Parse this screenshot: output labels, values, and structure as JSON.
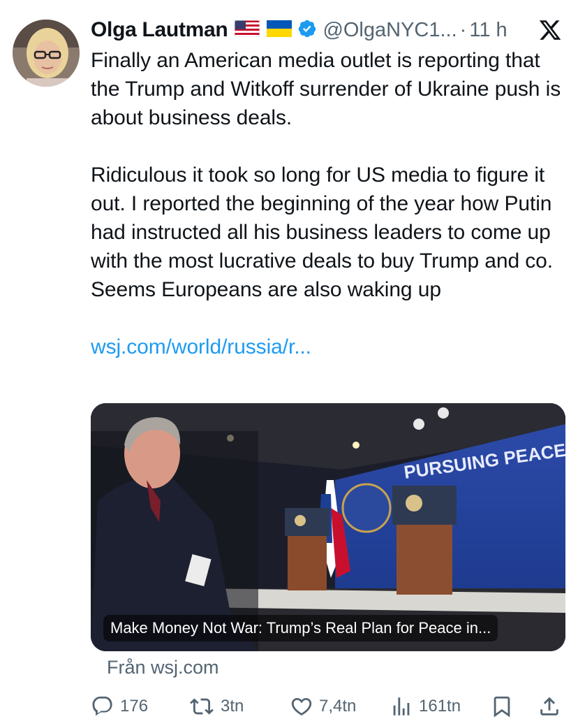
{
  "author": {
    "name": "Olga Lautman",
    "flags": [
      "us-flag",
      "ukraine-flag"
    ],
    "verified": true,
    "handle": "@OlgaNYC1...",
    "separator": "·",
    "time": "11 h"
  },
  "platform_icon": "x-logo-icon",
  "tweet": {
    "paragraph1": "Finally an American media outlet is reporting that the Trump and Witkoff surrender of Ukraine push is about business deals.",
    "paragraph2": "Ridiculous it took so long for US media to figure it out. I reported the beginning of the year how Putin had instructed all his business leaders to come up with the most lucrative deals to buy Trump and co. Seems Europeans are also waking up",
    "link_text": "wsj.com/world/russia/r..."
  },
  "card": {
    "image_text": "PURSUING PEACE",
    "caption": "Make Money Not War: Trump’s Real Plan for Peace in...",
    "source": "Från wsj.com"
  },
  "actions": {
    "replies": "176",
    "reposts": "3tn",
    "likes": "7,4tn",
    "views": "161tn"
  },
  "colors": {
    "text": "#0f1419",
    "muted": "#536471",
    "link": "#1d9bf0",
    "verified": "#1d9bf0"
  }
}
